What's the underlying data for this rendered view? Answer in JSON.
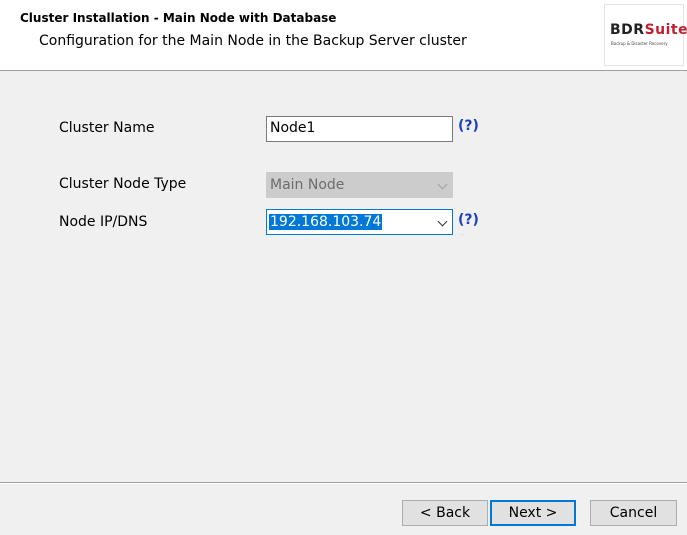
{
  "header": {
    "title": "Cluster Installation - Main Node with Database",
    "subtitle": "Configuration for the Main Node in the Backup Server cluster",
    "logo": {
      "bdr": "BDR",
      "suite": "Suite",
      "tagline": "Backup & Disaster Recovery"
    }
  },
  "form": {
    "cluster_name": {
      "label": "Cluster Name",
      "value": "Node1",
      "help": "(?)"
    },
    "node_type": {
      "label": "Cluster Node Type",
      "value": "Main Node"
    },
    "node_ip": {
      "label": "Node IP/DNS",
      "value": "192.168.103.74",
      "help": "(?)"
    }
  },
  "buttons": {
    "back": "< Back",
    "next": "Next >",
    "cancel": "Cancel"
  },
  "colors": {
    "accent": "#0078d7",
    "help": "#1c3fbf",
    "logo_red": "#c01f2f"
  },
  "icons": {
    "dropdown": "chevron-down-icon",
    "help": "help-icon"
  }
}
